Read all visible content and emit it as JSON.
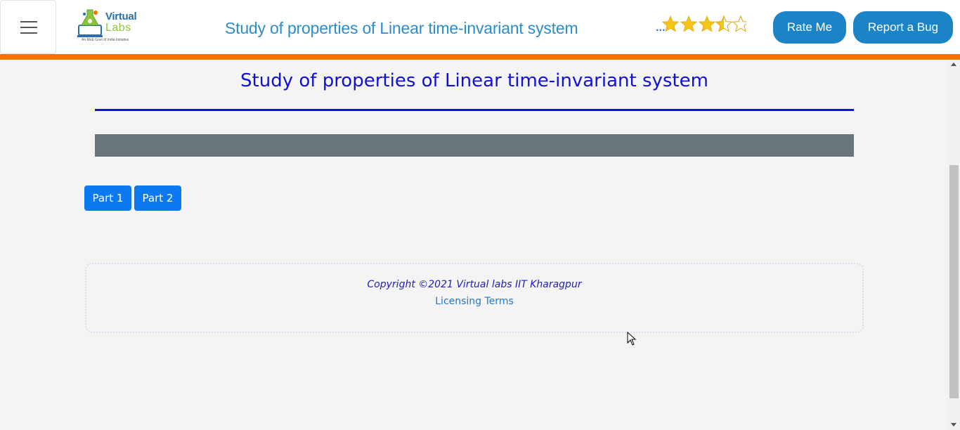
{
  "header": {
    "logo": {
      "line1": "Virtual",
      "line2": "Labs",
      "tagline": "An MoE Govt of India Initiative"
    },
    "title": "Study of properties of Linear time-invariant system",
    "rating": {
      "dots": "...",
      "value": 3.5,
      "max": 5
    },
    "rate_label": "Rate Me",
    "bug_label": "Report a Bug"
  },
  "main": {
    "title": "Study of properties of Linear time-invariant system",
    "parts": [
      "Part 1",
      "Part 2"
    ]
  },
  "footer": {
    "copyright": "Copyright ©2021 Virtual labs IIT Kharagpur",
    "licensing": "Licensing Terms"
  },
  "colors": {
    "accent_orange": "#f07306",
    "header_title": "#2b8ccc",
    "button_blue": "#1b84c6",
    "part_button": "#0d79f0",
    "page_title": "#1010d8",
    "star": "#f5c518"
  }
}
